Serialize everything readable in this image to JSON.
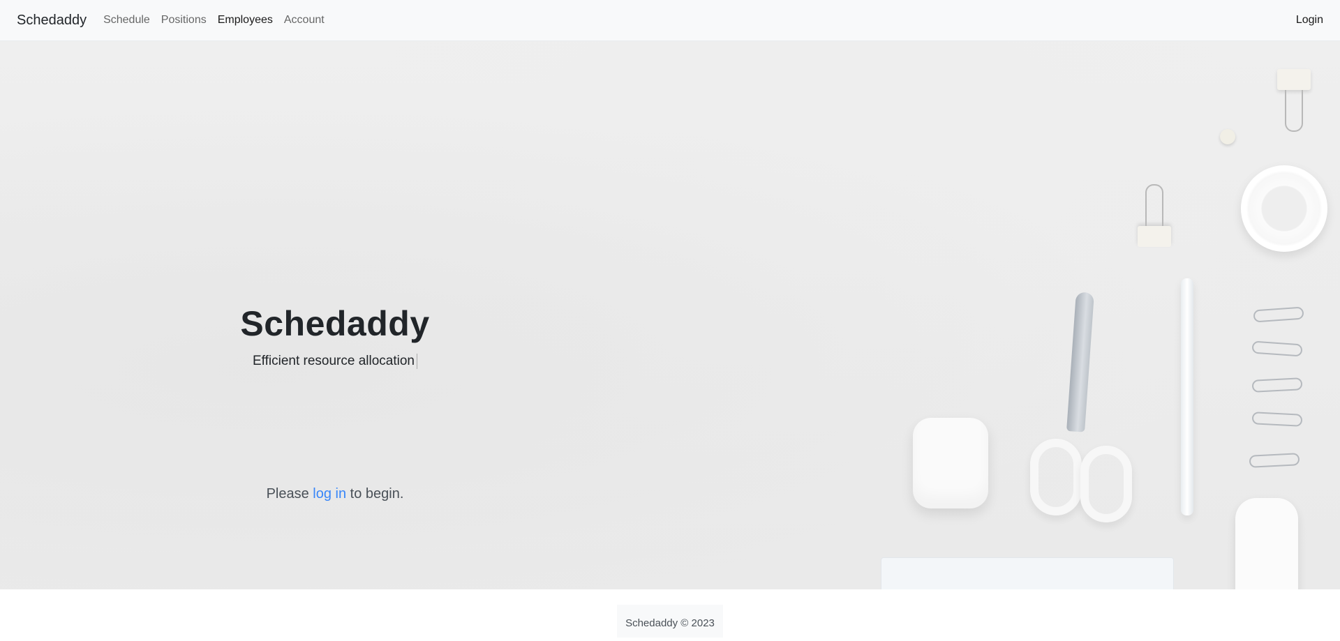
{
  "navbar": {
    "brand": "Schedaddy",
    "links": [
      {
        "label": "Schedule"
      },
      {
        "label": "Positions"
      },
      {
        "label": "Employees"
      },
      {
        "label": "Account"
      }
    ],
    "login_label": "Login"
  },
  "hero": {
    "title": "Schedaddy",
    "tagline": "Efficient resource allocation",
    "cta_prefix": "Please ",
    "cta_link": "log in",
    "cta_suffix": " to begin."
  },
  "footer": {
    "text": "Schedaddy © 2023"
  }
}
